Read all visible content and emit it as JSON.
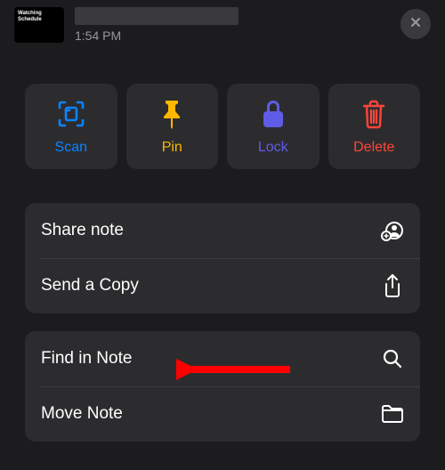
{
  "header": {
    "thumb_label": "Watching Schedule",
    "timestamp": "1:54 PM"
  },
  "actions": {
    "scan": "Scan",
    "pin": "Pin",
    "lock": "Lock",
    "delete": "Delete"
  },
  "menu1": {
    "share": "Share note",
    "send_copy": "Send a Copy"
  },
  "menu2": {
    "find": "Find in Note",
    "move": "Move Note"
  }
}
